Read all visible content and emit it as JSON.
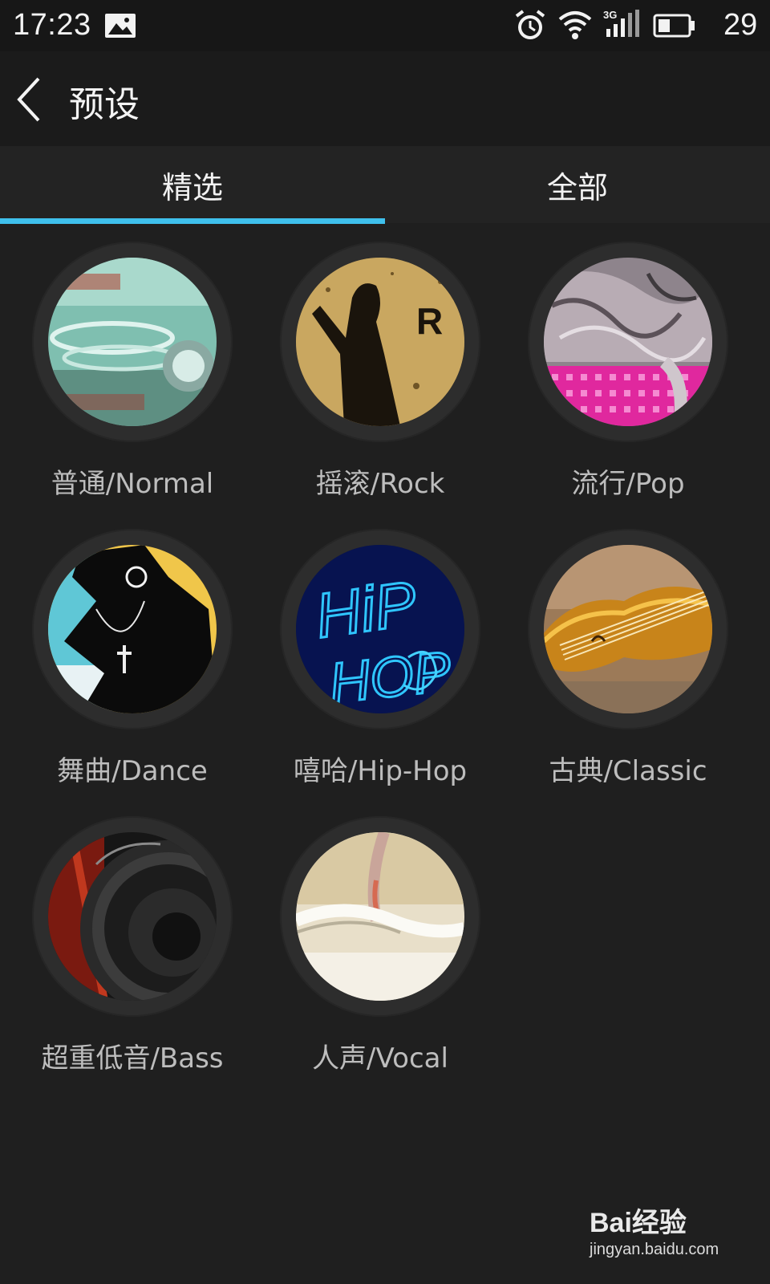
{
  "status_bar": {
    "time": "17:23",
    "battery": "29",
    "icons": [
      "image-icon",
      "alarm-icon",
      "wifi-icon",
      "3g-signal-icon",
      "battery-icon"
    ],
    "network": "3G"
  },
  "header": {
    "title": "预设",
    "back_icon": "chevron-left-icon"
  },
  "tabs": [
    {
      "label": "精选",
      "active": true
    },
    {
      "label": "全部",
      "active": false
    }
  ],
  "accent_color": "#3fc0ec",
  "presets": [
    {
      "label": "普通/Normal"
    },
    {
      "label": "摇滚/Rock",
      "art_text": "R"
    },
    {
      "label": "流行/Pop"
    },
    {
      "label": "舞曲/Dance"
    },
    {
      "label": "嘻哈/Hip-Hop",
      "art_text": "HiP HOP"
    },
    {
      "label": "古典/Classic"
    },
    {
      "label": "超重低音/Bass"
    },
    {
      "label": "人声/Vocal"
    }
  ],
  "watermark": {
    "logo": "Bai经验",
    "url": "jingyan.baidu.com"
  }
}
